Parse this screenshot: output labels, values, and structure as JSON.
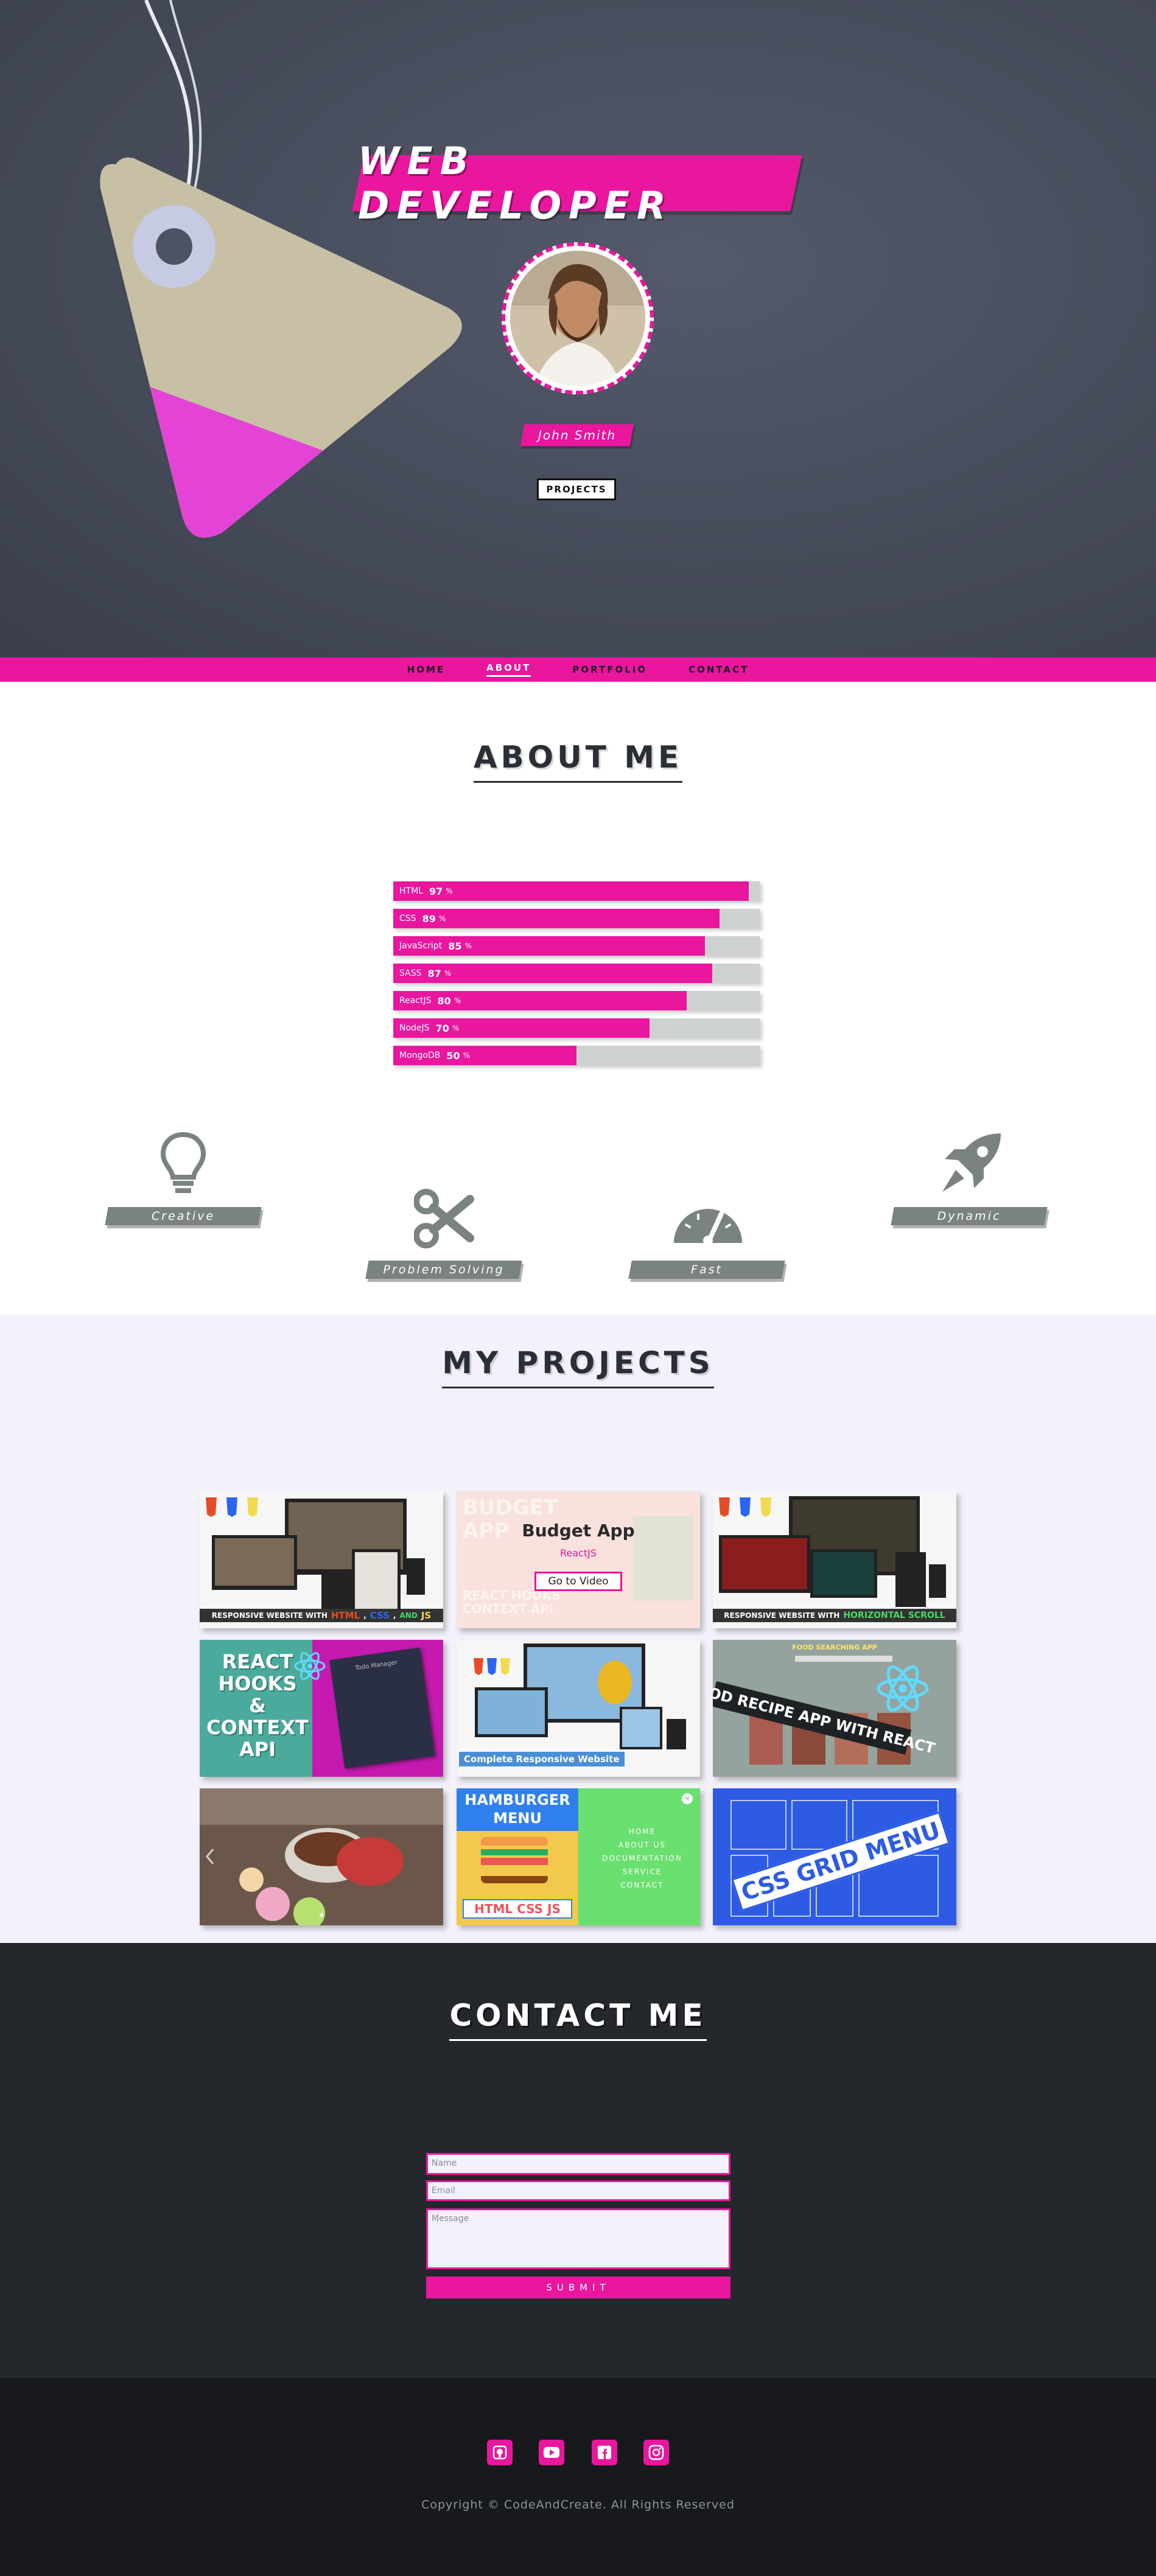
{
  "hero": {
    "title": "WEB DEVELOPER",
    "name": "John Smith",
    "projects_button": "PROJECTS"
  },
  "nav": {
    "items": [
      {
        "label": "HOME"
      },
      {
        "label": "ABOUT"
      },
      {
        "label": "PORTFOLIO"
      },
      {
        "label": "CONTACT"
      }
    ],
    "active": "ABOUT"
  },
  "about": {
    "title": "ABOUT ME",
    "skills": [
      {
        "name": "HTML",
        "value": "97",
        "unit": "%",
        "percent": 97
      },
      {
        "name": "CSS",
        "value": "89",
        "unit": "%",
        "percent": 89
      },
      {
        "name": "JavaScript",
        "value": "85",
        "unit": "%",
        "percent": 85
      },
      {
        "name": "SASS",
        "value": "87",
        "unit": "%",
        "percent": 87
      },
      {
        "name": "ReactJS",
        "value": "80",
        "unit": "%",
        "percent": 80
      },
      {
        "name": "NodeJS",
        "value": "70",
        "unit": "%",
        "percent": 70
      },
      {
        "name": "MongoDB",
        "value": "50",
        "unit": "%",
        "percent": 50
      }
    ],
    "features": [
      {
        "label": "Creative",
        "icon": "lightbulb-icon"
      },
      {
        "label": "Problem Solving",
        "icon": "scissors-icon"
      },
      {
        "label": "Fast",
        "icon": "speedometer-icon"
      },
      {
        "label": "Dynamic",
        "icon": "rocket-icon"
      }
    ]
  },
  "projects": {
    "title": "MY PROJECTS",
    "cards": [
      {
        "caption": "RESPONSIVE WEBSITE WITH",
        "tech_html": "HTML",
        "tech_css": "CSS",
        "tech_and": "AND",
        "tech_js": "JS"
      },
      {
        "title": "Budget App",
        "subtitle": "ReactJS",
        "button": "Go to Video",
        "bg_text_1": "BUDGET",
        "bg_text_2": "APP",
        "bg_text_3": "REACT HOOKS",
        "bg_text_4": "CONTEXT API"
      },
      {
        "caption": "RESPONSIVE WEBSITE WITH",
        "highlight": "HORIZONTAL SCROLL"
      },
      {
        "line1": "REACT",
        "line2": "HOOKS",
        "line3": "&",
        "line4": "CONTEXT",
        "line5": "API",
        "panel_title": "Todo Manager"
      },
      {
        "caption": "Complete Responsive Website"
      },
      {
        "header": "FOOD SEARCHING APP",
        "banner": "FOOD RECIPE APP WITH REACT"
      },
      {},
      {
        "title_1": "HAMBURGER",
        "title_2": "MENU",
        "tech": "HTML CSS JS",
        "menu": [
          "HOME",
          "ABOUT US",
          "DOCUMENTATION",
          "SERVICE",
          "CONTACT"
        ]
      },
      {
        "banner": "CSS GRID MENU"
      }
    ]
  },
  "contact": {
    "title": "CONTACT ME",
    "name_placeholder": "Name",
    "email_placeholder": "Email",
    "message_placeholder": "Message",
    "submit": "SUBMIT"
  },
  "footer": {
    "socials": [
      "github-icon",
      "youtube-icon",
      "facebook-icon",
      "instagram-icon"
    ],
    "copyright": "Copyright © CodeAndCreate. All Rights Reserved"
  },
  "colors": {
    "accent": "#e9169e",
    "hero_bg": "#4a4f5e",
    "grey_label": "#7a8381",
    "dark": "#24272b",
    "footer": "#17191c"
  }
}
